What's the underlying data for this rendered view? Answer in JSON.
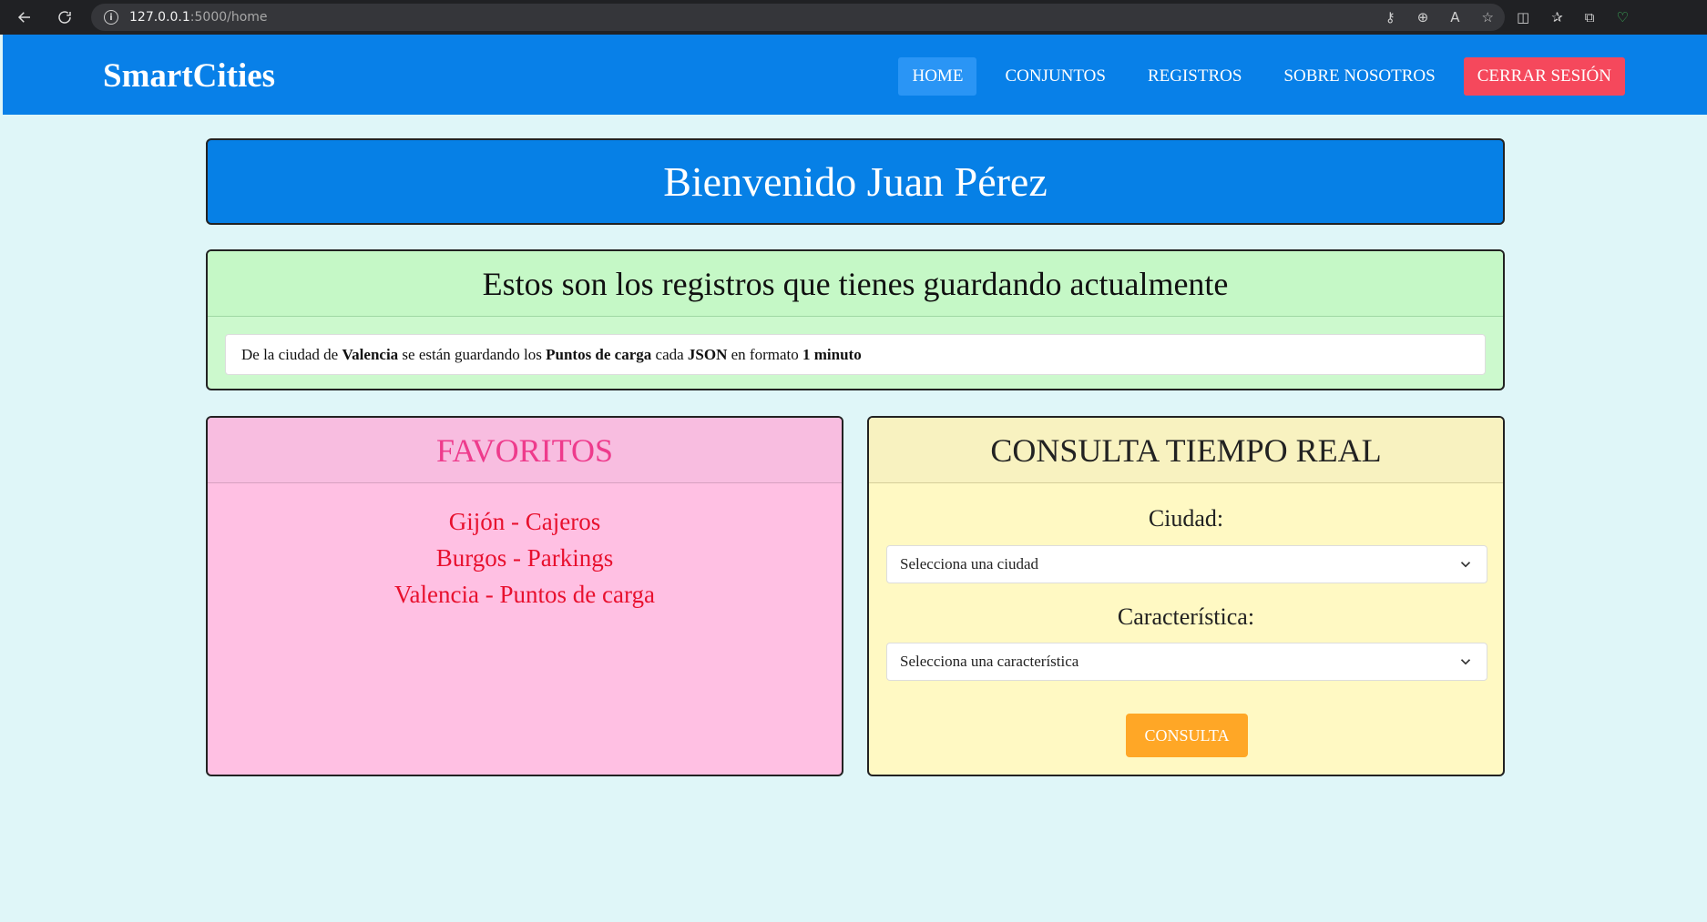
{
  "browser": {
    "url_host": "127.0.0.1",
    "url_path": ":5000/home"
  },
  "navbar": {
    "brand": "SmartCities",
    "items": [
      {
        "label": "HOME"
      },
      {
        "label": "CONJUNTOS"
      },
      {
        "label": "REGISTROS"
      },
      {
        "label": "SOBRE NOSOTROS"
      },
      {
        "label": "CERRAR SESIÓN"
      }
    ]
  },
  "welcome": {
    "title": "Bienvenido Juan Pérez"
  },
  "records": {
    "title": "Estos son los registros que tienes guardando actualmente",
    "entry": {
      "t1": "De la ciudad de ",
      "city": "Valencia",
      "t2": " se están guardando los ",
      "feature": "Puntos de carga",
      "t3": " cada ",
      "format": "JSON",
      "t4": " en formato ",
      "interval": "1 minuto"
    }
  },
  "favorites": {
    "title": "FAVORITOS",
    "items": [
      "Gijón - Cajeros",
      "Burgos - Parkings",
      "Valencia - Puntos de carga"
    ]
  },
  "realtime": {
    "title": "CONSULTA TIEMPO REAL",
    "city_label": "Ciudad:",
    "city_selected": "Selecciona una ciudad",
    "feature_label": "Característica:",
    "feature_selected": "Selecciona una característica",
    "button": "CONSULTA"
  },
  "colors": {
    "navbar": "#0880e8",
    "logout": "#f5485c",
    "consulta_button": "#ffa726"
  }
}
